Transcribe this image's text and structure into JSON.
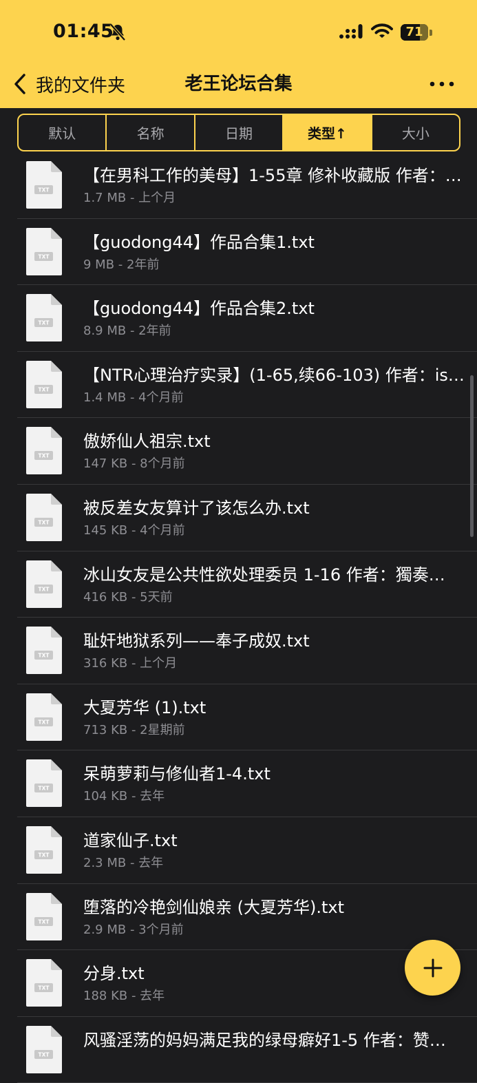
{
  "status_bar": {
    "time": "01:45",
    "battery": "71"
  },
  "nav": {
    "back_label": "我的文件夹",
    "title": "老王论坛合集"
  },
  "sort_tabs": [
    {
      "label": "默认",
      "active": false
    },
    {
      "label": "名称",
      "active": false
    },
    {
      "label": "日期",
      "active": false
    },
    {
      "label": "类型↑",
      "active": true
    },
    {
      "label": "大小",
      "active": false
    }
  ],
  "file_icon_label": "TXT",
  "files": [
    {
      "name": "【在男科工作的美母】1-55章 修补收藏版 作者：…",
      "meta": "1.7 MB - 上个月"
    },
    {
      "name": "【guodong44】作品合集1.txt",
      "meta": "9 MB - 2年前"
    },
    {
      "name": "【guodong44】作品合集2.txt",
      "meta": "8.9 MB - 2年前"
    },
    {
      "name": "【NTR心理治疗实录】(1-65,续66-103) 作者：isn…",
      "meta": "1.4 MB - 4个月前"
    },
    {
      "name": "傲娇仙人祖宗.txt",
      "meta": "147 KB - 8个月前"
    },
    {
      "name": "被反差女友算计了该怎么办.txt",
      "meta": "145 KB - 4个月前"
    },
    {
      "name": "冰山女友是公共性欲处理委员 1-16 作者：獨奏…",
      "meta": "416 KB - 5天前"
    },
    {
      "name": "耻奸地狱系列——奉子成奴.txt",
      "meta": "316 KB - 上个月"
    },
    {
      "name": "大夏芳华 (1).txt",
      "meta": "713 KB - 2星期前"
    },
    {
      "name": "呆萌萝莉与修仙者1-4.txt",
      "meta": "104 KB - 去年"
    },
    {
      "name": "道家仙子.txt",
      "meta": "2.3 MB - 去年"
    },
    {
      "name": "堕落的冷艳剑仙娘亲 (大夏芳华).txt",
      "meta": "2.9 MB - 3个月前"
    },
    {
      "name": "分身.txt",
      "meta": "188 KB - 去年"
    },
    {
      "name": "风骚淫荡的妈妈满足我的绿母癖好1-5 作者：赞…",
      "meta": ""
    }
  ]
}
